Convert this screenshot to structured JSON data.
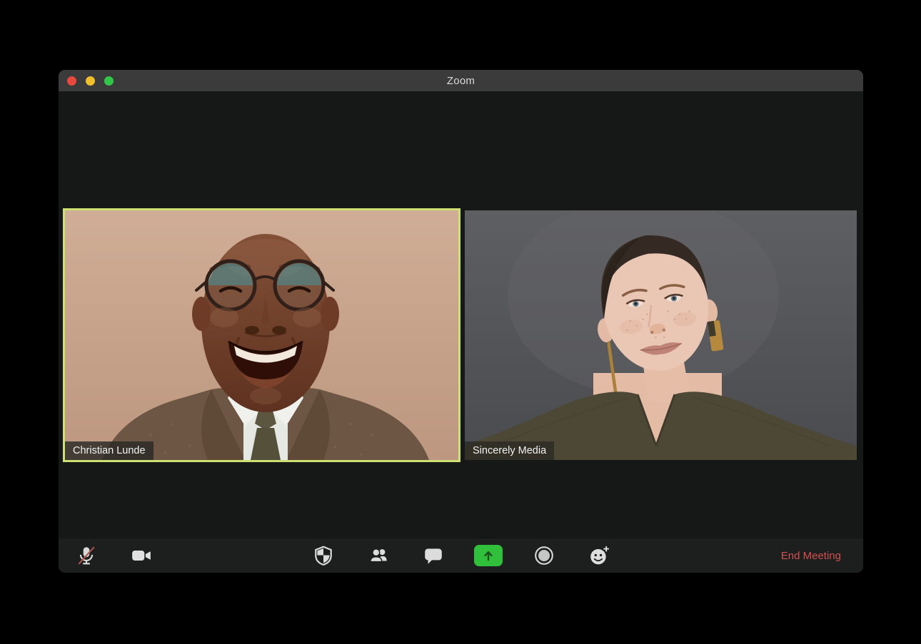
{
  "window": {
    "title": "Zoom"
  },
  "titlebar": {
    "buttons": [
      {
        "id": "close",
        "color": "#e8493f"
      },
      {
        "id": "minimize",
        "color": "#f2bf2c"
      },
      {
        "id": "fullscreen",
        "color": "#32c748"
      }
    ]
  },
  "participants": [
    {
      "name": "Christian Lunde",
      "active_speaker": true,
      "video_on": true
    },
    {
      "name": "Sincerely Media",
      "active_speaker": false,
      "video_on": true
    }
  ],
  "toolbar": {
    "buttons": [
      {
        "id": "mute",
        "icon": "microphone-muted-icon",
        "state": "muted"
      },
      {
        "id": "video",
        "icon": "video-camera-icon",
        "state": "on"
      },
      {
        "id": "security",
        "icon": "security-shield-icon"
      },
      {
        "id": "participants",
        "icon": "participants-icon"
      },
      {
        "id": "chat",
        "icon": "chat-bubble-icon"
      },
      {
        "id": "share-screen",
        "icon": "share-screen-icon"
      },
      {
        "id": "record",
        "icon": "record-icon"
      },
      {
        "id": "reactions",
        "icon": "reactions-smiley-icon"
      }
    ],
    "end_meeting_label": "End Meeting"
  },
  "colors": {
    "active_speaker_border": "#cde072",
    "share_button": "#31c03c",
    "end_meeting_text": "#d05050",
    "titlebar_bg": "#3b3b3b",
    "toolbar_bg": "#1d1f1f",
    "window_bg": "#161818"
  }
}
